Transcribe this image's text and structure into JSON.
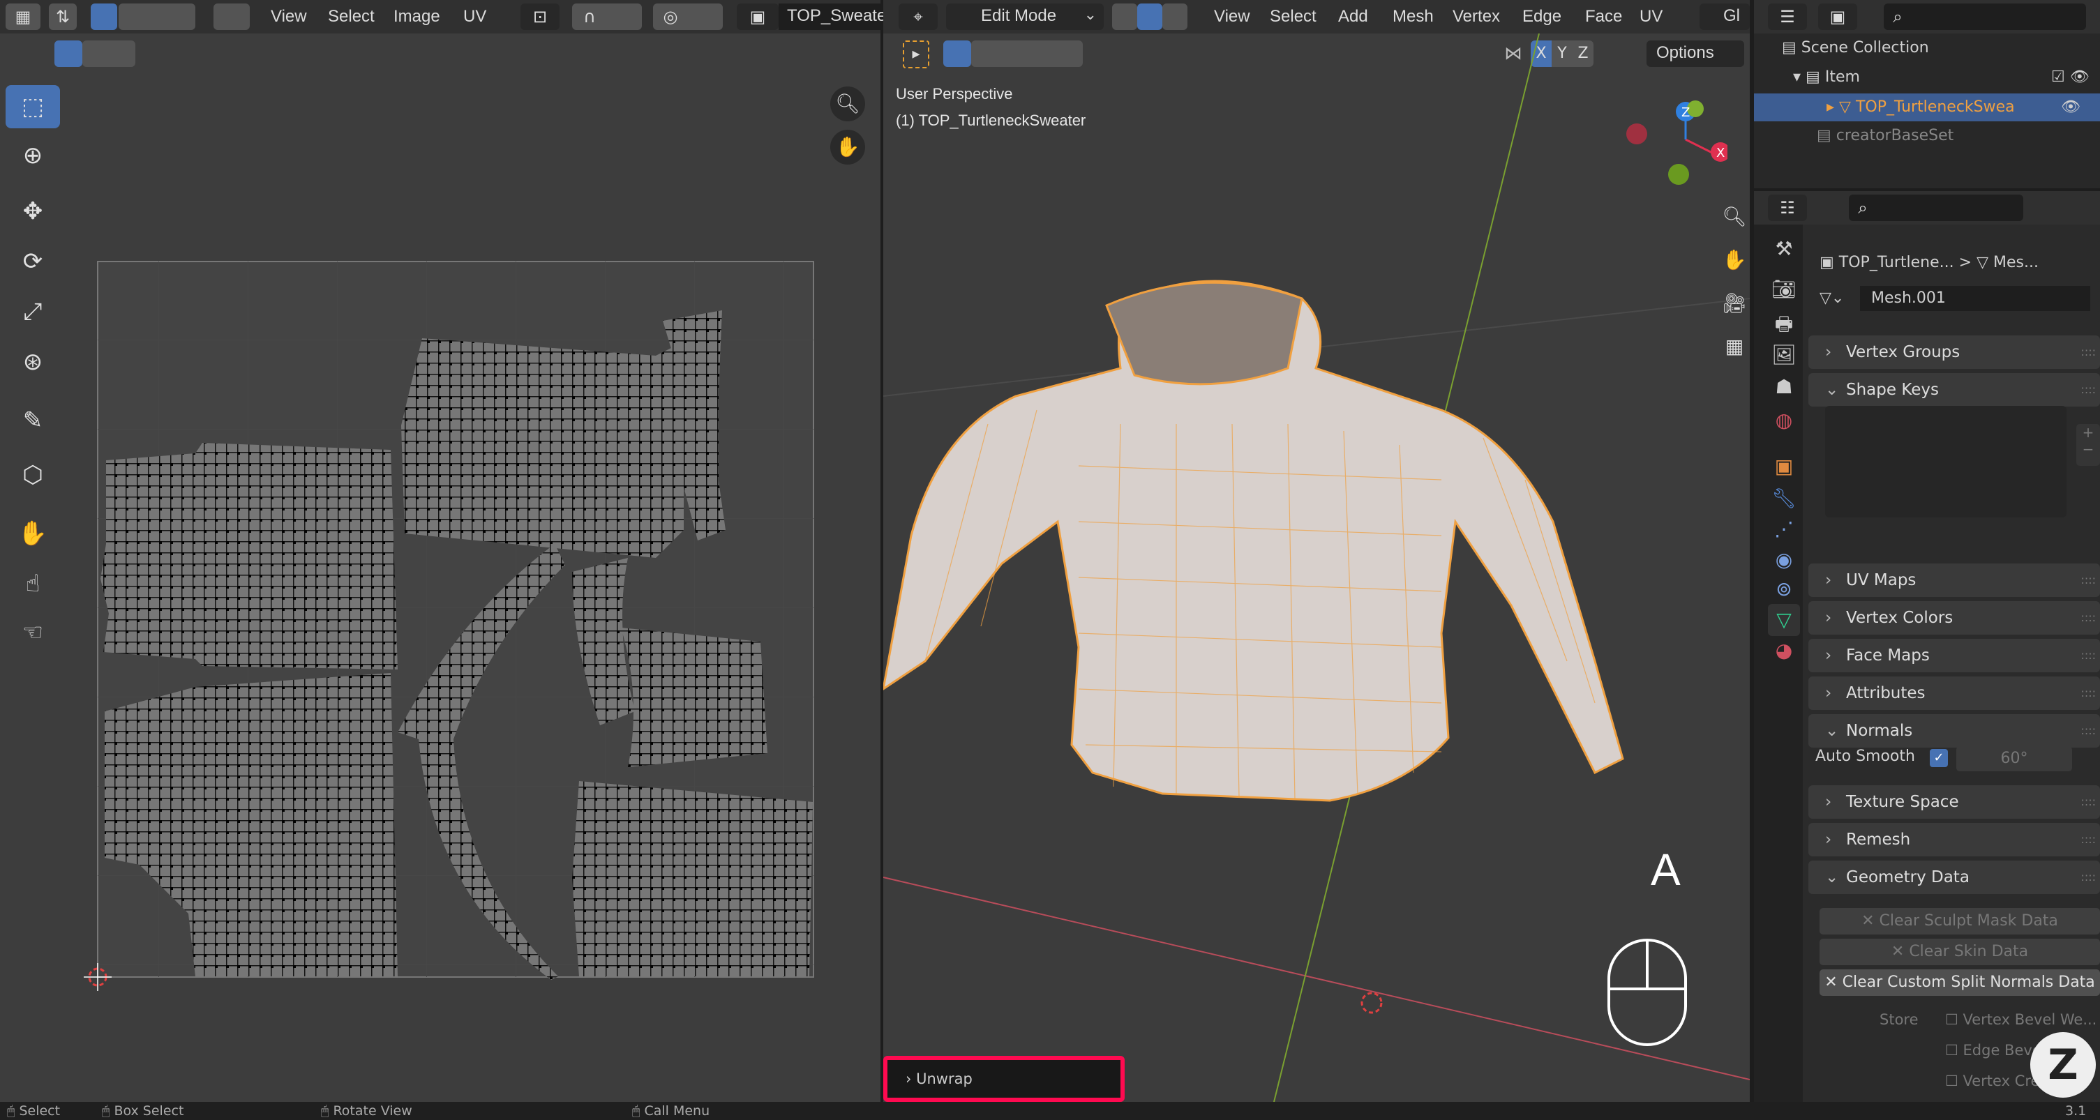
{
  "uv_editor": {
    "menus": [
      "View",
      "Select",
      "Image",
      "UV"
    ],
    "image_name": "TOP_Sweate"
  },
  "viewport": {
    "mode": "Edit Mode",
    "menus": [
      "View",
      "Select",
      "Add",
      "Mesh",
      "Vertex",
      "Edge",
      "Face",
      "UV"
    ],
    "orientation": "Gl",
    "axes": [
      "X",
      "Y",
      "Z"
    ],
    "options_label": "Options",
    "view_name": "User Perspective",
    "object_label": "(1) TOP_TurtleneckSweater",
    "key_overlay": "A",
    "operator_panel": "Unwrap",
    "highlight_color": "#ff0a50",
    "mesh_color": "#f0a040"
  },
  "outliner": {
    "items": [
      {
        "label": "Scene Collection"
      },
      {
        "label": "Item"
      },
      {
        "label": "TOP_TurtleneckSwea",
        "selected": true
      },
      {
        "label": "creatorBaseSet"
      }
    ]
  },
  "properties": {
    "breadcrumb_object": "TOP_Turtlene...",
    "breadcrumb_mesh": "Mes...",
    "mesh_name": "Mesh.001",
    "panels": [
      {
        "label": "Vertex Groups",
        "open": false
      },
      {
        "label": "Shape Keys",
        "open": true
      },
      {
        "label": "UV Maps",
        "open": false
      },
      {
        "label": "Vertex Colors",
        "open": false
      },
      {
        "label": "Face Maps",
        "open": false
      },
      {
        "label": "Attributes",
        "open": false
      },
      {
        "label": "Normals",
        "open": true
      },
      {
        "label": "Texture Space",
        "open": false
      },
      {
        "label": "Remesh",
        "open": false
      },
      {
        "label": "Geometry Data",
        "open": true
      }
    ],
    "auto_smooth_label": "Auto Smooth",
    "auto_smooth_checked": true,
    "auto_smooth_angle": "60°",
    "geometry_buttons": [
      "Clear Sculpt Mask Data",
      "Clear Skin Data",
      "Clear Custom Split Normals Data"
    ],
    "store_label": "Store",
    "store_options": [
      "Vertex Bevel We...",
      "Edge Bevel We...",
      "Vertex Crease"
    ]
  },
  "status_bar": {
    "items": [
      "Select",
      "Box Select",
      "Rotate View",
      "Call Menu"
    ],
    "version": "3.1"
  }
}
